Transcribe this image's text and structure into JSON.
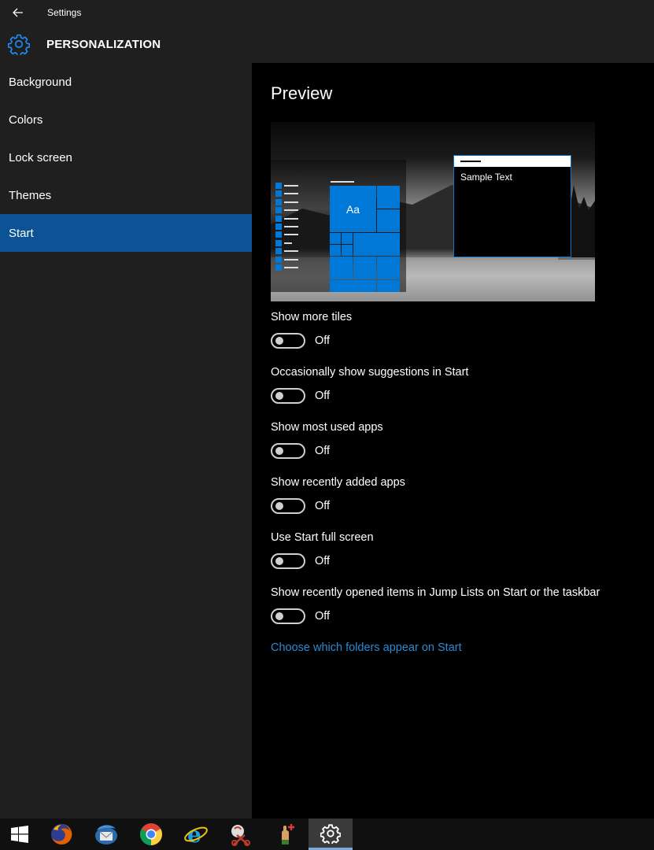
{
  "window": {
    "title": "Settings"
  },
  "header": {
    "title": "PERSONALIZATION",
    "icon": "gear-icon"
  },
  "sidebar": {
    "items": [
      {
        "label": "Background"
      },
      {
        "label": "Colors"
      },
      {
        "label": "Lock screen"
      },
      {
        "label": "Themes"
      },
      {
        "label": "Start",
        "selected": true
      }
    ]
  },
  "main": {
    "preview_title": "Preview",
    "preview": {
      "tile_label": "Aa",
      "window_text": "Sample Text"
    },
    "settings": [
      {
        "label": "Show more tiles",
        "state": "Off"
      },
      {
        "label": "Occasionally show suggestions in Start",
        "state": "Off"
      },
      {
        "label": "Show most used apps",
        "state": "Off"
      },
      {
        "label": "Show recently added apps",
        "state": "Off"
      },
      {
        "label": "Use Start full screen",
        "state": "Off"
      },
      {
        "label": "Show recently opened items in Jump Lists on Start or the taskbar",
        "state": "Off"
      }
    ],
    "link": "Choose which folders appear on Start"
  },
  "taskbar": {
    "items": [
      "windows-start-icon",
      "firefox-icon",
      "thunderbird-icon",
      "chrome-icon",
      "internet-explorer-icon",
      "snipping-tool-icon",
      "app-icon",
      "settings-gear-icon"
    ]
  },
  "colors": {
    "accent": "#0078d7",
    "selected_nav": "#0b5394",
    "link": "#2a8ad4",
    "sidebar_bg": "#1f1f1f",
    "main_bg": "#000000"
  }
}
